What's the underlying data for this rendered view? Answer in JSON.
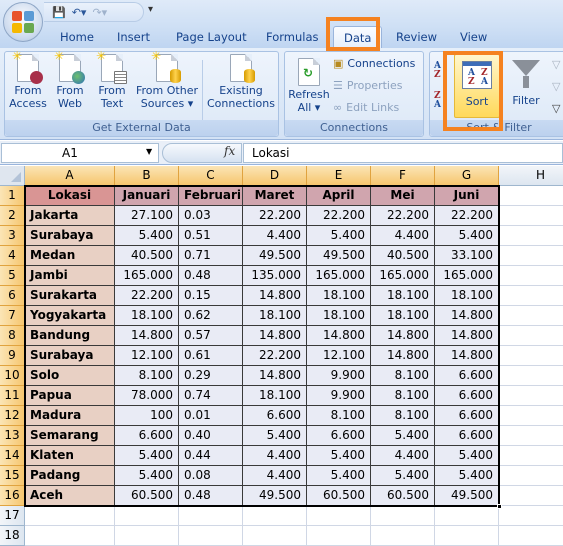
{
  "quick_access": {
    "save": "save-icon",
    "undo": "undo-icon",
    "redo": "redo-icon",
    "customize": "▾"
  },
  "tabs": [
    {
      "label": "Home"
    },
    {
      "label": "Insert"
    },
    {
      "label": "Page Layout"
    },
    {
      "label": "Formulas"
    },
    {
      "label": "Data",
      "active": true
    },
    {
      "label": "Review"
    },
    {
      "label": "View"
    }
  ],
  "ribbon": {
    "get_external_data": {
      "label": "Get External Data",
      "from_access": [
        "From",
        "Access"
      ],
      "from_web": [
        "From",
        "Web"
      ],
      "from_text": [
        "From",
        "Text"
      ],
      "from_other": [
        "From Other",
        "Sources ▾"
      ],
      "existing": [
        "Existing",
        "Connections"
      ]
    },
    "connections": {
      "label": "Connections",
      "refresh": [
        "Refresh",
        "All ▾"
      ],
      "connections": "Connections",
      "properties": "Properties",
      "edit_links": "Edit Links"
    },
    "sort_filter": {
      "label": "Sort & Filter",
      "sort_az": [
        "A",
        "Z"
      ],
      "sort_za": [
        "Z",
        "A"
      ],
      "sort": "Sort",
      "filter": "Filter"
    }
  },
  "formula_bar": {
    "name_box": "A1",
    "fx": "fx",
    "content": "Lokasi"
  },
  "colors": {
    "highlight": "#f58220",
    "header_fill": "#d0a5ae",
    "location_fill": "#e8d0c4",
    "data_fill": "#e9ebf5"
  },
  "columns": [
    "A",
    "B",
    "C",
    "D",
    "E",
    "F",
    "G",
    "H"
  ],
  "rows": [
    "1",
    "2",
    "3",
    "4",
    "5",
    "6",
    "7",
    "8",
    "9",
    "10",
    "11",
    "12",
    "13",
    "14",
    "15",
    "16",
    "17",
    "18"
  ],
  "table": {
    "headers": [
      "Lokasi",
      "Januari",
      "Februari",
      "Maret",
      "April",
      "Mei",
      "Juni"
    ],
    "data": [
      [
        "Jakarta",
        "27.100",
        "0.03",
        "22.200",
        "22.200",
        "22.200",
        "22.200"
      ],
      [
        "Surabaya",
        "5.400",
        "0.51",
        "4.400",
        "5.400",
        "4.400",
        "5.400"
      ],
      [
        "Medan",
        "40.500",
        "0.71",
        "49.500",
        "49.500",
        "40.500",
        "33.100"
      ],
      [
        "Jambi",
        "165.000",
        "0.48",
        "135.000",
        "165.000",
        "165.000",
        "165.000"
      ],
      [
        "Surakarta",
        "22.200",
        "0.15",
        "14.800",
        "18.100",
        "18.100",
        "18.100"
      ],
      [
        "Yogyakarta",
        "18.100",
        "0.62",
        "18.100",
        "18.100",
        "18.100",
        "14.800"
      ],
      [
        "Bandung",
        "14.800",
        "0.57",
        "14.800",
        "14.800",
        "14.800",
        "14.800"
      ],
      [
        "Surabaya",
        "12.100",
        "0.61",
        "22.200",
        "12.100",
        "14.800",
        "14.800"
      ],
      [
        "Solo",
        "8.100",
        "0.29",
        "14.800",
        "9.900",
        "8.100",
        "6.600"
      ],
      [
        "Papua",
        "78.000",
        "0.74",
        "18.100",
        "9.900",
        "8.100",
        "6.600"
      ],
      [
        "Madura",
        "100",
        "0.01",
        "6.600",
        "8.100",
        "8.100",
        "6.600"
      ],
      [
        "Semarang",
        "6.600",
        "0.40",
        "5.400",
        "6.600",
        "5.400",
        "6.600"
      ],
      [
        "Klaten",
        "5.400",
        "0.44",
        "4.400",
        "5.400",
        "4.400",
        "5.400"
      ],
      [
        "Padang",
        "5.400",
        "0.08",
        "4.400",
        "5.400",
        "5.400",
        "5.400"
      ],
      [
        "Aceh",
        "60.500",
        "0.48",
        "49.500",
        "60.500",
        "60.500",
        "49.500"
      ]
    ]
  }
}
